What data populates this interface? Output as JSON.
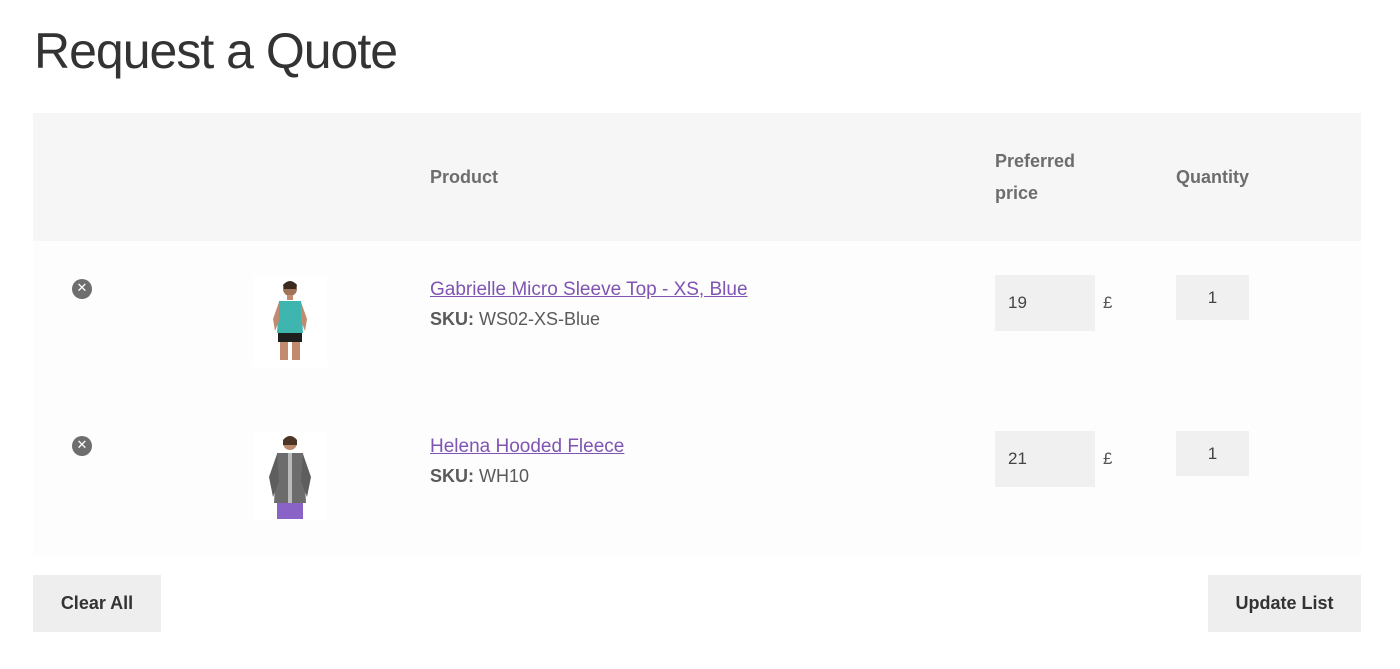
{
  "page": {
    "title": "Request a Quote"
  },
  "table": {
    "headers": {
      "product": "Product",
      "preferred_price_line1": "Preferred",
      "preferred_price_line2": "price",
      "quantity": "Quantity"
    },
    "sku_label": "SKU:",
    "currency_symbol": "£",
    "rows": [
      {
        "product_name": "Gabrielle Micro Sleeve Top - XS, Blue",
        "sku": "WS02-XS-Blue",
        "preferred_price": "19",
        "quantity": "1"
      },
      {
        "product_name": "Helena Hooded Fleece",
        "sku": "WH10",
        "preferred_price": "21",
        "quantity": "1"
      }
    ]
  },
  "actions": {
    "clear_all": "Clear All",
    "update_list": "Update List"
  },
  "icons": {
    "remove": "close-circle-icon"
  },
  "colors": {
    "link": "#7f54b3",
    "header_bg": "#f6f6f6",
    "input_bg": "#f0f0f0",
    "button_bg": "#eeeeee"
  }
}
